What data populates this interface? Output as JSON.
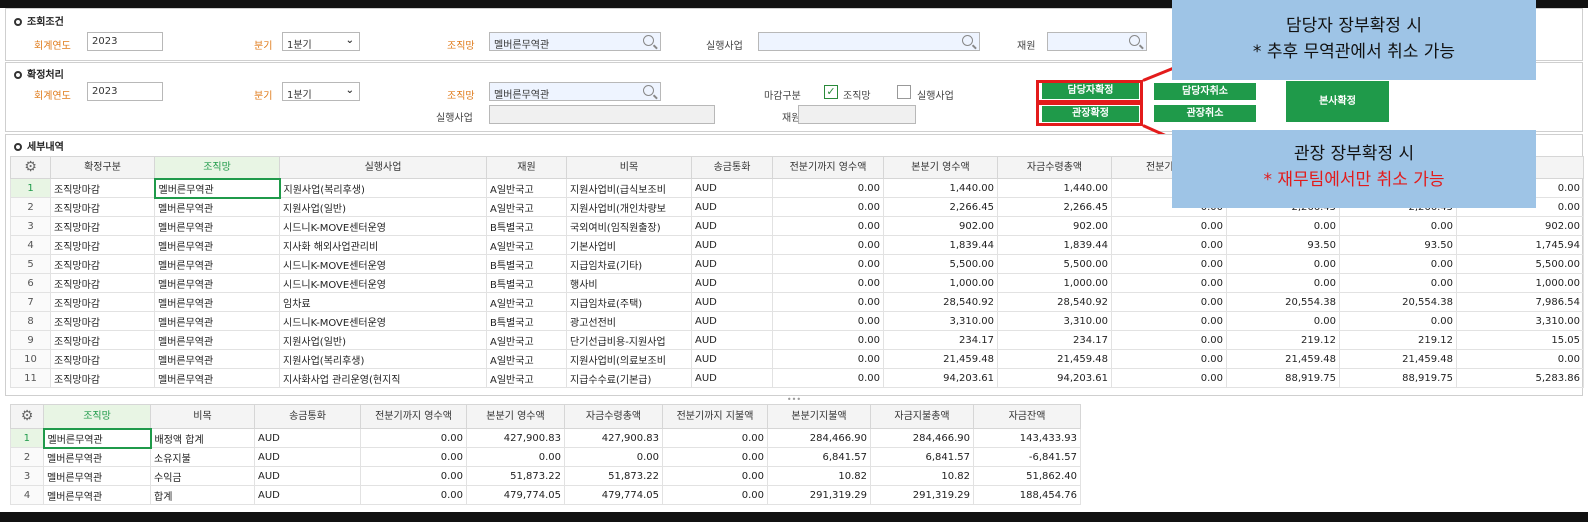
{
  "search": {
    "title": "조회조건",
    "year_label": "회계연도",
    "year_value": "2023",
    "quarter_label": "분기",
    "quarter_value": "1분기",
    "org_label": "조직망",
    "org_value": "멜버른무역관",
    "project_label": "실행사업",
    "project_value": "",
    "fund_label": "재원",
    "fund_value": ""
  },
  "confirm": {
    "title": "확정처리",
    "year_label": "회계연도",
    "year_value": "2023",
    "quarter_label": "분기",
    "quarter_value": "1분기",
    "org_label": "조직망",
    "org_value": "멜버른무역관",
    "close_label": "마감구분",
    "check_org": "조직망",
    "check_project": "실행사업",
    "project_label": "실행사업",
    "fund_label": "재원",
    "btn_manager_confirm": "담당자확정",
    "btn_manager_cancel": "담당자취소",
    "btn_head_confirm": "관장확정",
    "btn_head_cancel": "관장취소",
    "btn_hq_confirm": "본사확정"
  },
  "callouts": {
    "top_line1": "담당자 장부확정 시",
    "top_line2": "* 추후 무역관에서 취소 가능",
    "bottom_line1": "관장 장부확정 시",
    "bottom_line2": "* 재무팀에서만 취소 가능"
  },
  "detail": {
    "title": "세부내역",
    "headers": [
      "확정구분",
      "조직망",
      "실행사업",
      "재원",
      "비목",
      "송금통화",
      "전분기까지 영수액",
      "본분기 영수액",
      "자금수령총액",
      "전분기까지"
    ],
    "rows": [
      {
        "no": "1",
        "status": "조직망마감",
        "org": "멜버른무역관",
        "project": "지원사업(복리후생)",
        "fund": "A일반국고",
        "item": "지원사업비(급식보조비",
        "cur": "AUD",
        "prev_recv": "0.00",
        "q_recv": "1,440.00",
        "total_recv": "1,440.00",
        "c10": "",
        "c11": "",
        "c12": "",
        "c13": "0.00"
      },
      {
        "no": "2",
        "status": "조직망마감",
        "org": "멜버른무역관",
        "project": "지원사업(일반)",
        "fund": "A일반국고",
        "item": "지원사업비(개인차량보",
        "cur": "AUD",
        "prev_recv": "0.00",
        "q_recv": "2,266.45",
        "total_recv": "2,266.45",
        "c10": "0.00",
        "c11": "2,266.45",
        "c12": "2,266.45",
        "c13": "0.00"
      },
      {
        "no": "3",
        "status": "조직망마감",
        "org": "멜버른무역관",
        "project": "시드니K-MOVE센터운영",
        "fund": "B특별국고",
        "item": "국외여비(임직원출장)",
        "cur": "AUD",
        "prev_recv": "0.00",
        "q_recv": "902.00",
        "total_recv": "902.00",
        "c10": "0.00",
        "c11": "0.00",
        "c12": "0.00",
        "c13": "902.00"
      },
      {
        "no": "4",
        "status": "조직망마감",
        "org": "멜버른무역관",
        "project": "지사화 해외사업관리비",
        "fund": "A일반국고",
        "item": "기본사업비",
        "cur": "AUD",
        "prev_recv": "0.00",
        "q_recv": "1,839.44",
        "total_recv": "1,839.44",
        "c10": "0.00",
        "c11": "93.50",
        "c12": "93.50",
        "c13": "1,745.94"
      },
      {
        "no": "5",
        "status": "조직망마감",
        "org": "멜버른무역관",
        "project": "시드니K-MOVE센터운영",
        "fund": "B특별국고",
        "item": "지급임차료(기타)",
        "cur": "AUD",
        "prev_recv": "0.00",
        "q_recv": "5,500.00",
        "total_recv": "5,500.00",
        "c10": "0.00",
        "c11": "0.00",
        "c12": "0.00",
        "c13": "5,500.00"
      },
      {
        "no": "6",
        "status": "조직망마감",
        "org": "멜버른무역관",
        "project": "시드니K-MOVE센터운영",
        "fund": "B특별국고",
        "item": "행사비",
        "cur": "AUD",
        "prev_recv": "0.00",
        "q_recv": "1,000.00",
        "total_recv": "1,000.00",
        "c10": "0.00",
        "c11": "0.00",
        "c12": "0.00",
        "c13": "1,000.00"
      },
      {
        "no": "7",
        "status": "조직망마감",
        "org": "멜버른무역관",
        "project": "임차료",
        "fund": "A일반국고",
        "item": "지급임차료(주택)",
        "cur": "AUD",
        "prev_recv": "0.00",
        "q_recv": "28,540.92",
        "total_recv": "28,540.92",
        "c10": "0.00",
        "c11": "20,554.38",
        "c12": "20,554.38",
        "c13": "7,986.54"
      },
      {
        "no": "8",
        "status": "조직망마감",
        "org": "멜버른무역관",
        "project": "시드니K-MOVE센터운영",
        "fund": "B특별국고",
        "item": "광고선전비",
        "cur": "AUD",
        "prev_recv": "0.00",
        "q_recv": "3,310.00",
        "total_recv": "3,310.00",
        "c10": "0.00",
        "c11": "0.00",
        "c12": "0.00",
        "c13": "3,310.00"
      },
      {
        "no": "9",
        "status": "조직망마감",
        "org": "멜버른무역관",
        "project": "지원사업(일반)",
        "fund": "A일반국고",
        "item": "단기선급비용-지원사업",
        "cur": "AUD",
        "prev_recv": "0.00",
        "q_recv": "234.17",
        "total_recv": "234.17",
        "c10": "0.00",
        "c11": "219.12",
        "c12": "219.12",
        "c13": "15.05"
      },
      {
        "no": "10",
        "status": "조직망마감",
        "org": "멜버른무역관",
        "project": "지원사업(복리후생)",
        "fund": "A일반국고",
        "item": "지원사업비(의료보조비",
        "cur": "AUD",
        "prev_recv": "0.00",
        "q_recv": "21,459.48",
        "total_recv": "21,459.48",
        "c10": "0.00",
        "c11": "21,459.48",
        "c12": "21,459.48",
        "c13": "0.00"
      },
      {
        "no": "11",
        "status": "조직망마감",
        "org": "멜버른무역관",
        "project": "지사화사업 관리운영(현지직",
        "fund": "A일반국고",
        "item": "지급수수료(기본급)",
        "cur": "AUD",
        "prev_recv": "0.00",
        "q_recv": "94,203.61",
        "total_recv": "94,203.61",
        "c10": "0.00",
        "c11": "88,919.75",
        "c12": "88,919.75",
        "c13": "5,283.86"
      }
    ]
  },
  "summary": {
    "headers": [
      "조직망",
      "비목",
      "송금통화",
      "전분기까지 영수액",
      "본분기 영수액",
      "자금수령총액",
      "전분기까지 지불액",
      "본분기지불액",
      "자금지불총액",
      "자금잔액"
    ],
    "rows": [
      {
        "no": "1",
        "org": "멜버른무역관",
        "item": "배정액 합계",
        "cur": "AUD",
        "a": "0.00",
        "b": "427,900.83",
        "c": "427,900.83",
        "d": "0.00",
        "e": "284,466.90",
        "f": "284,466.90",
        "g": "143,433.93"
      },
      {
        "no": "2",
        "org": "멜버른무역관",
        "item": "소유지불",
        "cur": "AUD",
        "a": "0.00",
        "b": "0.00",
        "c": "0.00",
        "d": "0.00",
        "e": "6,841.57",
        "f": "6,841.57",
        "g": "-6,841.57"
      },
      {
        "no": "3",
        "org": "멜버른무역관",
        "item": "수익금",
        "cur": "AUD",
        "a": "0.00",
        "b": "51,873.22",
        "c": "51,873.22",
        "d": "0.00",
        "e": "10.82",
        "f": "10.82",
        "g": "51,862.40"
      },
      {
        "no": "4",
        "org": "멜버른무역관",
        "item": "합계",
        "cur": "AUD",
        "a": "0.00",
        "b": "479,774.05",
        "c": "479,774.05",
        "d": "0.00",
        "e": "291,319.29",
        "f": "291,319.29",
        "g": "188,454.76"
      }
    ]
  },
  "icons": {
    "settings": "gear-icon",
    "search": "search-icon",
    "dropdown": "chevron-down-icon",
    "check": "check-icon"
  },
  "colors": {
    "accent_green": "#1f9a4a",
    "label_orange": "#e07b1a",
    "annotation_red": "#e31b1b",
    "callout_blue": "#9ec4e6"
  }
}
